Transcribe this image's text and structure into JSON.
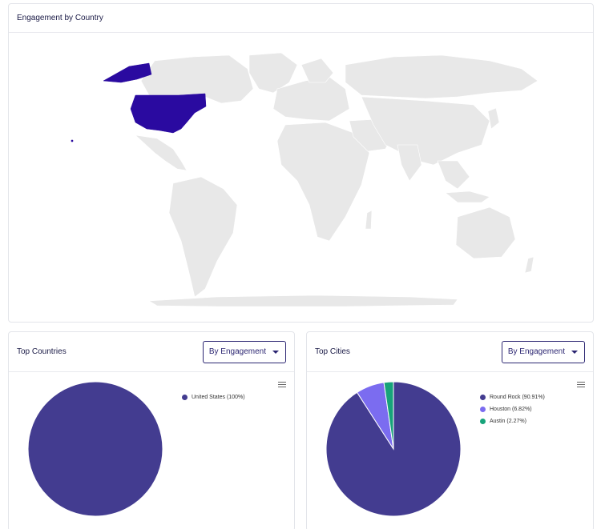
{
  "map_card": {
    "title": "Engagement by Country",
    "highlight_color": "#2a0aa0",
    "base_color": "#e8e8e8"
  },
  "countries_card": {
    "title": "Top Countries",
    "dropdown_label": "By Engagement",
    "legend": [
      {
        "label": "United States (100%)",
        "color": "#433c90"
      }
    ]
  },
  "cities_card": {
    "title": "Top Cities",
    "dropdown_label": "By Engagement",
    "legend": [
      {
        "label": "Round Rock (90.91%)",
        "color": "#433c90"
      },
      {
        "label": "Houston (6.82%)",
        "color": "#7b6cf0"
      },
      {
        "label": "Austin (2.27%)",
        "color": "#17a37a"
      }
    ]
  },
  "chart_data": [
    {
      "type": "pie",
      "categories": [
        "United States"
      ],
      "values": [
        100
      ]
    },
    {
      "type": "pie",
      "categories": [
        "Round Rock",
        "Houston",
        "Austin"
      ],
      "values": [
        90.91,
        6.82,
        2.27
      ]
    }
  ]
}
